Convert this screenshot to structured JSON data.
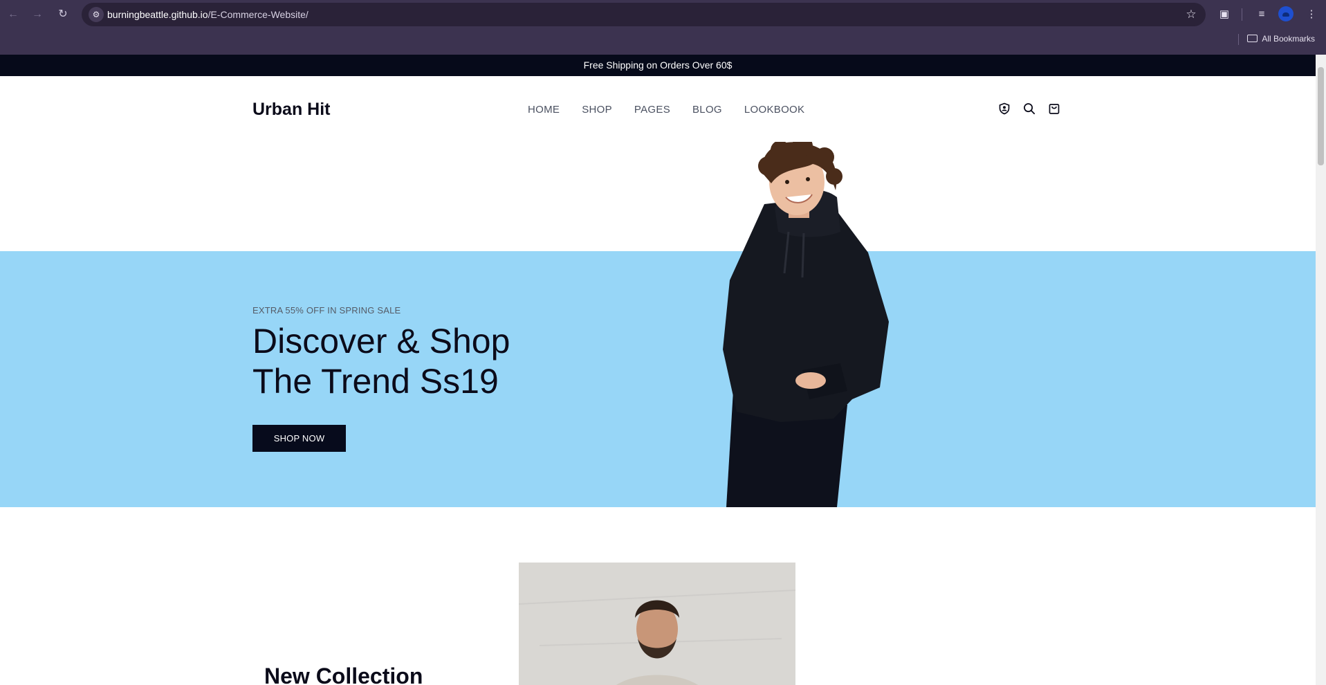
{
  "browser": {
    "url_host": "burningbeattle.github.io",
    "url_path": "/E-Commerce-Website/",
    "bookmarks_label": "All Bookmarks",
    "icons": [
      "back-icon",
      "forward-icon",
      "reload-icon",
      "site-settings-icon",
      "star-icon",
      "extensions-icon",
      "media-icon",
      "profile-avatar",
      "menu-icon",
      "folder-icon"
    ]
  },
  "topbar": {
    "text": "Free Shipping on Orders Over 60$"
  },
  "header": {
    "logo": "Urban Hit",
    "menu": [
      "HOME",
      "SHOP",
      "PAGES",
      "BLOG",
      "LOOKBOOK"
    ],
    "icons": [
      "account-shield-icon",
      "search-icon",
      "cart-bag-icon"
    ]
  },
  "hero": {
    "eyebrow": "EXTRA 55% OFF IN SPRING SALE",
    "title_line1": "Discover & Shop",
    "title_line2": "The Trend Ss19",
    "cta": "SHOP NOW",
    "band_color": "#97d6f7"
  },
  "collection": {
    "title": "New Collection"
  },
  "colors": {
    "dark": "#070b1c",
    "chrome": "#3c3350"
  }
}
